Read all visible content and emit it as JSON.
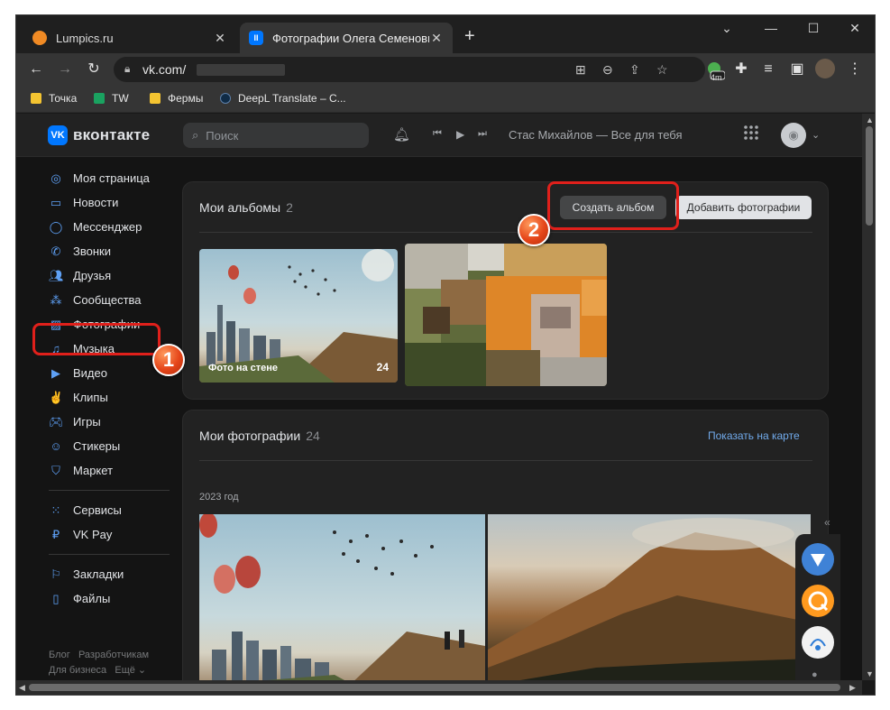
{
  "browser": {
    "tabs": [
      {
        "title": "Lumpics.ru",
        "active": false
      },
      {
        "title": "Фотографии Олега Семеновича",
        "active": true
      }
    ],
    "new_tab_icon": "plus-icon",
    "window_controls": [
      "chevron-down-icon",
      "minimize-icon",
      "maximize-icon",
      "close-icon"
    ],
    "address": {
      "url_visible": "vk.com/"
    },
    "extension_badge": "4m",
    "bookmarks": [
      {
        "label": "Точка",
        "icon": "folder-icon",
        "color": "#f4c431"
      },
      {
        "label": "TW",
        "icon": "tw-icon",
        "color": "#1aa260"
      },
      {
        "label": "Фермы",
        "icon": "folder-icon",
        "color": "#f4c431"
      },
      {
        "label": "DeepL Translate – С...",
        "icon": "deepl-icon",
        "color": "#0f2b46"
      }
    ]
  },
  "vk": {
    "logo_text": "вконтакте",
    "search_placeholder": "Поиск",
    "now_playing": "Стас Михайлов — Все для тебя",
    "nav": [
      {
        "label": "Моя страница",
        "icon": "user-circle-icon"
      },
      {
        "label": "Новости",
        "icon": "news-icon"
      },
      {
        "label": "Мессенджер",
        "icon": "chat-icon"
      },
      {
        "label": "Звонки",
        "icon": "phone-icon"
      },
      {
        "label": "Друзья",
        "icon": "friends-icon"
      },
      {
        "label": "Сообщества",
        "icon": "communities-icon"
      },
      {
        "label": "Фотографии",
        "icon": "photo-icon"
      },
      {
        "label": "Музыка",
        "icon": "music-icon"
      },
      {
        "label": "Видео",
        "icon": "video-icon"
      },
      {
        "label": "Клипы",
        "icon": "clips-icon"
      },
      {
        "label": "Игры",
        "icon": "gamepad-icon"
      },
      {
        "label": "Стикеры",
        "icon": "smile-icon"
      },
      {
        "label": "Маркет",
        "icon": "bag-icon"
      }
    ],
    "nav2": [
      {
        "label": "Сервисы",
        "icon": "grid-icon"
      },
      {
        "label": "VK Pay",
        "icon": "ruble-icon"
      }
    ],
    "nav3": [
      {
        "label": "Закладки",
        "icon": "bookmark-icon"
      },
      {
        "label": "Файлы",
        "icon": "file-icon"
      }
    ],
    "footer": {
      "line1": [
        "Блог",
        "Разработчикам"
      ],
      "line2": [
        "Для бизнеса",
        "Ещё ⌄"
      ]
    },
    "albums": {
      "title": "Мои альбомы",
      "count": "2",
      "create_button": "Создать альбом",
      "add_button": "Добавить фотографии",
      "items": [
        {
          "label": "Фото на стене",
          "count": "24"
        }
      ]
    },
    "photos": {
      "title": "Мои фотографии",
      "count": "24",
      "map_link": "Показать на карте",
      "year": "2023 год"
    }
  },
  "annotations": {
    "step1": "1",
    "step2": "2",
    "color": "#e0201b"
  }
}
